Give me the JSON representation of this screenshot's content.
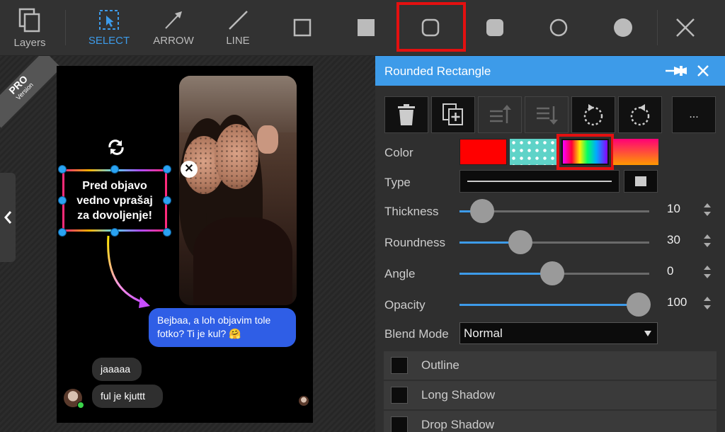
{
  "toolbar": {
    "layers_label": "Layers",
    "select_label": "SELECT",
    "arrow_label": "ARROW",
    "line_label": "LINE"
  },
  "badge": {
    "pro": "PRO",
    "version": "Version"
  },
  "canvas": {
    "textbox_text_1": "Pred objavo",
    "textbox_text_2": "vedno vprašaj",
    "textbox_text_3": "za dovoljenje!",
    "blue_message_1": "Bejbaa, a loh objavim tole",
    "blue_message_2": "fotko? Ti je kul? 🤗",
    "grey_message_1": "jaaaaa",
    "grey_message_2": "ful je kjuttt"
  },
  "panel": {
    "title": "Rounded Rectangle",
    "more_label": "...",
    "color_label": "Color",
    "type_label": "Type",
    "thickness_label": "Thickness",
    "thickness_value": "10",
    "roundness_label": "Roundness",
    "roundness_value": "30",
    "angle_label": "Angle",
    "angle_value": "0",
    "opacity_label": "Opacity",
    "opacity_value": "100",
    "blend_label": "Blend Mode",
    "blend_value": "Normal",
    "outline_label": "Outline",
    "long_shadow_label": "Long Shadow",
    "drop_shadow_label": "Drop Shadow"
  },
  "slider_levels": {
    "thickness": 0.12,
    "roundness": 0.32,
    "angle": 0.49,
    "opacity": 1.0
  },
  "colors": {
    "accent": "#3d9be9",
    "highlight": "#e41010",
    "solid_red": "#ff0000",
    "teal_pattern": "#5fd3c8"
  }
}
